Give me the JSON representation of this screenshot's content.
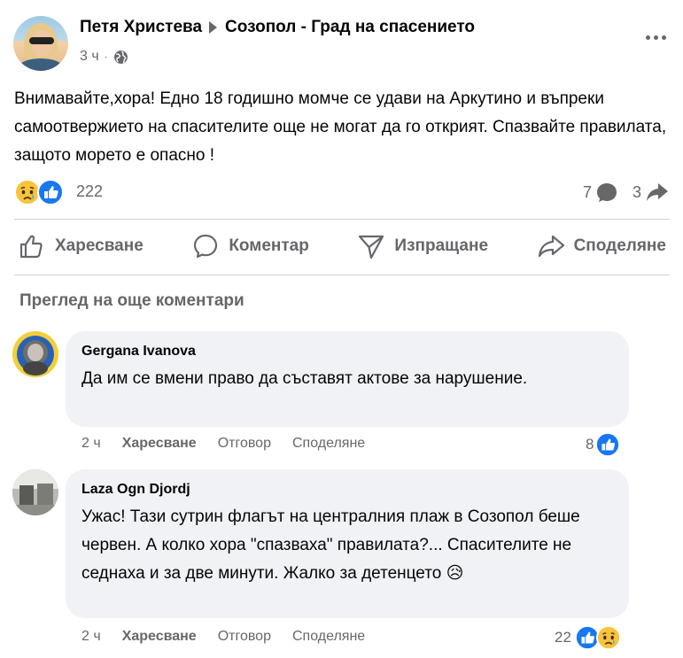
{
  "post": {
    "author": "Петя Христева",
    "group": "Созопол - Град на спасението",
    "time": "3 ч",
    "text": "Внимавайте,хора! Едно 18 годишно момче се удави на Аркутино и въпреки самоотвержието на спасителите още не могат да го открият. Спазвайте правилата, защото морето е опасно !",
    "reactions_count": "222",
    "comments_count": "7",
    "shares_count": "3"
  },
  "actions": {
    "like": "Харесване",
    "comment": "Коментар",
    "send": "Изпращане",
    "share": "Споделяне"
  },
  "view_more_comments": "Преглед на още коментари",
  "comments": [
    {
      "name": "Gergana Ivanova",
      "text": "Да им се вмени право да съставят актове за нарушение.",
      "time": "2 ч",
      "like_label": "Харесване",
      "reply_label": "Отговор",
      "share_label": "Споделяне",
      "reactions_count": "8"
    },
    {
      "name": "Laza Ogn Djordj",
      "text": "Ужас! Тази сутрин флагът на централния плаж в Созопол беше червен. А колко хора \"спазваха\" правилата?... Спасителите не седнаха и за две минути. Жалко за детенцето",
      "emoji": "😥",
      "time": "2 ч",
      "like_label": "Харесване",
      "reply_label": "Отговор",
      "share_label": "Споделяне",
      "reactions_count": "22"
    }
  ],
  "colors": {
    "primary_text": "#050505",
    "secondary_text": "#65676b",
    "like_blue": "#1877f2",
    "bubble_bg": "#f0f2f5",
    "divider": "#ced0d4",
    "sad_yellow": "#f7c43b"
  }
}
